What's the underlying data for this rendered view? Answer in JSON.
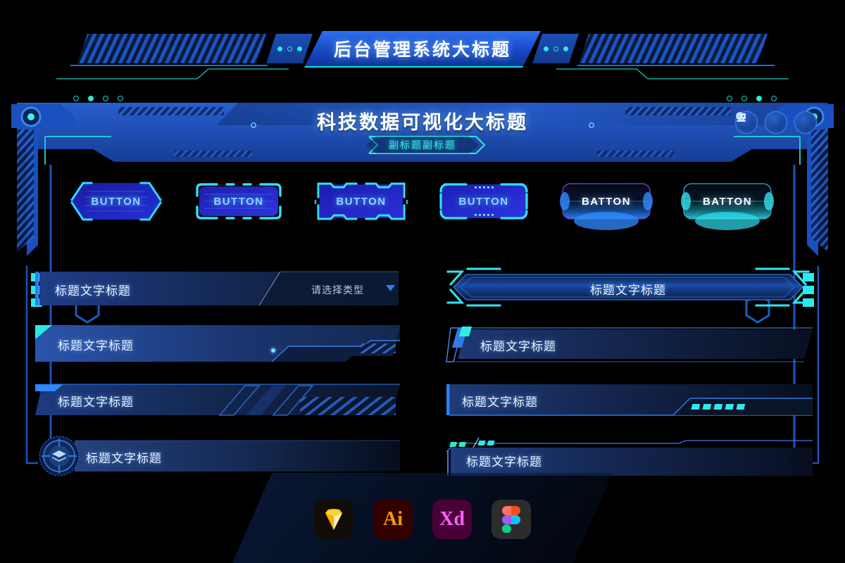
{
  "top_banner": {
    "title": "后台管理系统大标题",
    "left_dots": [
      "filled",
      "hollow",
      "filled"
    ],
    "right_dots": [
      "filled",
      "hollow",
      "filled"
    ],
    "left_mini_dots": [
      "hollow",
      "filled",
      "hollow",
      "hollow"
    ],
    "right_mini_dots": [
      "hollow",
      "hollow",
      "filled",
      "hollow"
    ]
  },
  "header": {
    "title": "科技数据可视化大标题",
    "subtitle": "副标题副标题",
    "icons": [
      {
        "name": "search-icon"
      },
      {
        "name": "message-icon"
      },
      {
        "name": "user-icon"
      }
    ]
  },
  "buttons": [
    {
      "label": "BUTTON",
      "style": "hexagon"
    },
    {
      "label": "BUTTON",
      "style": "rounded-brackets"
    },
    {
      "label": "BUTTON",
      "style": "notched-corners"
    },
    {
      "label": "BUTTON",
      "style": "dotted-capsule"
    },
    {
      "label": "BATTON",
      "style": "glow-blue"
    },
    {
      "label": "BATTON",
      "style": "glow-cyan"
    }
  ],
  "left_bars": [
    {
      "title": "标题文字标题",
      "select_value": "请选择类型",
      "style": "with-select"
    },
    {
      "title": "标题文字标题",
      "style": "angled-stripes"
    },
    {
      "title": "标题文字标题",
      "style": "diagonal-hatch"
    },
    {
      "title": "标题文字标题",
      "style": "radar-icon"
    }
  ],
  "right_bars": [
    {
      "title": "标题文字标题",
      "style": "centered-hexbanner"
    },
    {
      "title": "标题文字标题",
      "style": "slanted-accent"
    },
    {
      "title": "标题文字标题",
      "style": "dash-indicators"
    },
    {
      "title": "标题文字标题",
      "style": "corner-ticks"
    }
  ],
  "apps": [
    {
      "name": "sketch",
      "label": ""
    },
    {
      "name": "illustrator",
      "label": "Ai"
    },
    {
      "name": "adobe-xd",
      "label": "Xd"
    },
    {
      "name": "figma",
      "label": ""
    }
  ],
  "colors": {
    "accent_cyan": "#2ee8f0",
    "accent_blue": "#1f6fe0",
    "bg": "#000000",
    "panel_blue": "#123a8e"
  }
}
